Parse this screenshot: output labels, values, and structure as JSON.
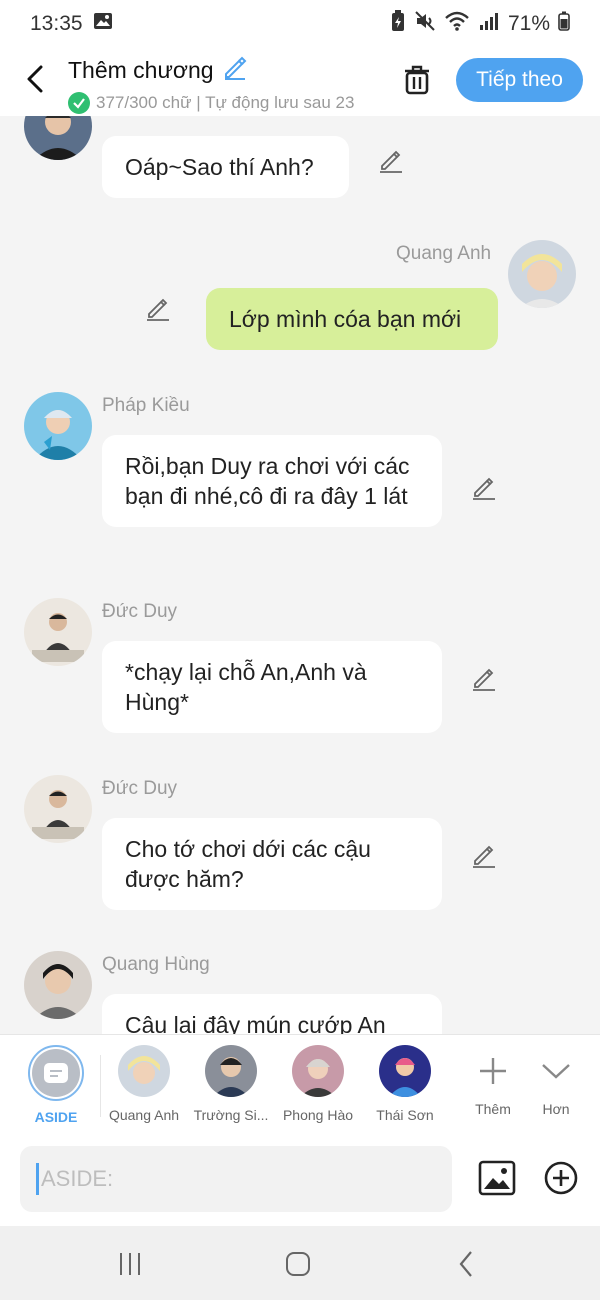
{
  "status_bar": {
    "time": "13:35",
    "battery": "71%"
  },
  "header": {
    "title": "Thêm chương",
    "subtitle": "377/300 chữ | Tự động lưu sau 23",
    "next_label": "Tiếp theo"
  },
  "messages": [
    {
      "sender": "",
      "text": "Oáp~Sao thí Anh?",
      "side": "left"
    },
    {
      "sender": "Quang Anh",
      "text": "Lớp mình cóa bạn mới",
      "side": "right"
    },
    {
      "sender": "Pháp Kiều",
      "text": "Rồi,bạn Duy ra chơi với các bạn đi nhé,cô đi ra đây 1 lát",
      "side": "left"
    },
    {
      "sender": "Đức Duy",
      "text": "*chạy lại chỗ An,Anh và Hùng*",
      "side": "left"
    },
    {
      "sender": "Đức Duy",
      "text": "Cho tớ chơi dới các cậu được hăm?",
      "side": "left"
    },
    {
      "sender": "Quang Hùng",
      "text": "Cậu lại đây mún cướp An",
      "side": "left"
    }
  ],
  "characters": {
    "aside_label": "ASIDE",
    "items": [
      {
        "name": "Quang Anh"
      },
      {
        "name": "Trường Si..."
      },
      {
        "name": "Phong Hào"
      },
      {
        "name": "Thái Sơn"
      }
    ],
    "more_label": "Thêm",
    "expand_label": "Hơn"
  },
  "input": {
    "placeholder": "ASIDE:"
  },
  "colors": {
    "accent": "#4fa3f0",
    "my_bubble": "#d7ef9a",
    "success": "#2fbf71"
  }
}
